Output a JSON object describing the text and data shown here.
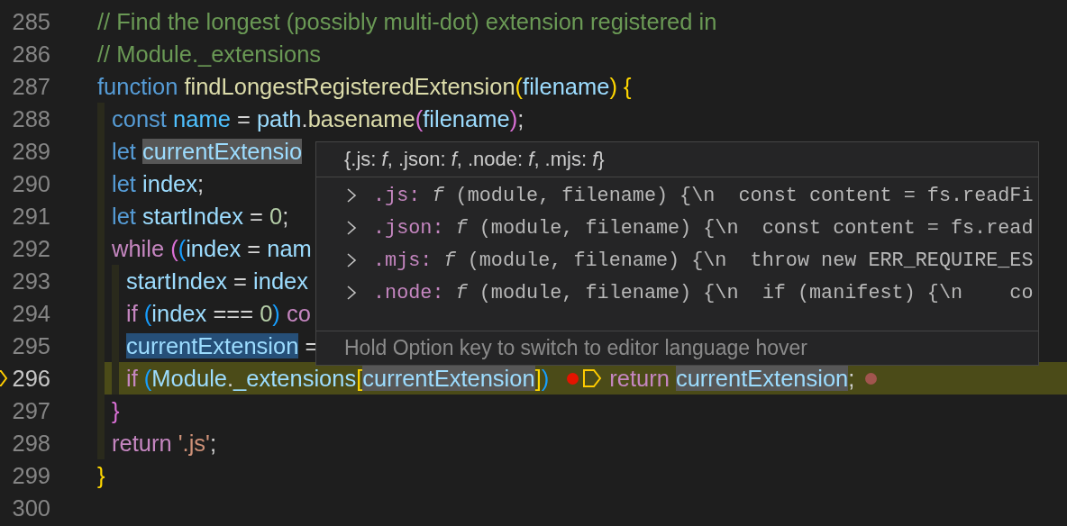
{
  "lines": [
    {
      "number": "285",
      "current": false,
      "tokens": [
        {
          "kind": "comment",
          "text": "// Find the longest (possibly multi-dot) extension registered in"
        }
      ]
    },
    {
      "number": "286",
      "current": false,
      "tokens": [
        {
          "kind": "comment",
          "text": "// Module._extensions"
        }
      ]
    },
    {
      "number": "287",
      "current": false,
      "tokens": [
        {
          "kind": "keyword",
          "text": "function "
        },
        {
          "kind": "fn",
          "text": "findLongestRegisteredExtension"
        },
        {
          "kind": "bracket1",
          "text": "("
        },
        {
          "kind": "var",
          "text": "filename"
        },
        {
          "kind": "bracket1",
          "text": ")"
        },
        {
          "kind": "bracket1",
          "text": " {"
        }
      ],
      "children": [
        {
          "number": "288",
          "current": false,
          "tokens": [
            {
              "kind": "keyword",
              "text": "const "
            },
            {
              "kind": "const",
              "text": "name"
            },
            {
              "kind": "plain",
              "text": " = "
            },
            {
              "kind": "var",
              "text": "path"
            },
            {
              "kind": "plain",
              "text": "."
            },
            {
              "kind": "fn",
              "text": "basename"
            },
            {
              "kind": "bracket2",
              "text": "("
            },
            {
              "kind": "var",
              "text": "filename"
            },
            {
              "kind": "bracket2",
              "text": ")"
            },
            {
              "kind": "plain",
              "text": ";"
            }
          ]
        },
        {
          "number": "289",
          "current": false,
          "tokens": [
            {
              "kind": "keyword",
              "text": "let "
            },
            {
              "kind": "var",
              "text": "currentExtensio",
              "highlighted": true
            }
          ]
        },
        {
          "number": "290",
          "current": false,
          "tokens": [
            {
              "kind": "keyword",
              "text": "let "
            },
            {
              "kind": "var",
              "text": "index"
            },
            {
              "kind": "plain",
              "text": ";"
            }
          ]
        },
        {
          "number": "291",
          "current": false,
          "tokens": [
            {
              "kind": "keyword",
              "text": "let "
            },
            {
              "kind": "var",
              "text": "startIndex"
            },
            {
              "kind": "plain",
              "text": " = "
            },
            {
              "kind": "number",
              "text": "0"
            },
            {
              "kind": "plain",
              "text": ";"
            }
          ]
        },
        {
          "number": "292",
          "current": false,
          "tokens": [
            {
              "kind": "control",
              "text": "while "
            },
            {
              "kind": "bracket2",
              "text": "("
            },
            {
              "kind": "bracket3",
              "text": "("
            },
            {
              "kind": "var",
              "text": "index"
            },
            {
              "kind": "plain",
              "text": " = "
            },
            {
              "kind": "var",
              "text": "nam"
            }
          ],
          "children": [
            {
              "number": "293",
              "current": false,
              "tokens": [
                {
                  "kind": "var",
                  "text": "startIndex"
                },
                {
                  "kind": "plain",
                  "text": " = "
                },
                {
                  "kind": "var",
                  "text": "index"
                }
              ]
            },
            {
              "number": "294",
              "current": false,
              "tokens": [
                {
                  "kind": "control",
                  "text": "if "
                },
                {
                  "kind": "bracket3",
                  "text": "("
                },
                {
                  "kind": "var",
                  "text": "index"
                },
                {
                  "kind": "plain",
                  "text": " === "
                },
                {
                  "kind": "number",
                  "text": "0"
                },
                {
                  "kind": "bracket3",
                  "text": ")"
                },
                {
                  "kind": "control",
                  "text": " co"
                }
              ]
            },
            {
              "number": "295",
              "current": false,
              "tokens": [
                {
                  "kind": "var",
                  "text": "currentExtension",
                  "selected": true
                },
                {
                  "kind": "plain",
                  "text": " ="
                }
              ]
            },
            {
              "number": "296",
              "current": true,
              "tokens": [
                {
                  "kind": "control",
                  "text": "if "
                },
                {
                  "kind": "bracket3",
                  "text": "("
                },
                {
                  "kind": "var",
                  "text": "Module"
                },
                {
                  "kind": "plain",
                  "text": "."
                },
                {
                  "kind": "var",
                  "text": "_extensions"
                },
                {
                  "kind": "bracket1",
                  "text": "["
                },
                {
                  "kind": "var",
                  "text": "currentExtension",
                  "highlighted": true
                },
                {
                  "kind": "bracket1",
                  "text": "]"
                },
                {
                  "kind": "bracket3",
                  "text": ")"
                },
                {
                  "kind": "breakpoint"
                },
                {
                  "kind": "stop-marker"
                },
                {
                  "kind": "control",
                  "text": "return "
                },
                {
                  "kind": "var",
                  "text": "currentExtension",
                  "highlighted": true
                },
                {
                  "kind": "plain",
                  "text": ";"
                },
                {
                  "kind": "breakpoint-dim"
                }
              ]
            }
          ]
        },
        {
          "number": "297",
          "current": false,
          "tokens": [
            {
              "kind": "bracket2",
              "text": "}"
            }
          ]
        },
        {
          "number": "298",
          "current": false,
          "tokens": [
            {
              "kind": "control",
              "text": "return "
            },
            {
              "kind": "string",
              "text": "'.js'"
            },
            {
              "kind": "plain",
              "text": ";"
            }
          ]
        }
      ]
    },
    {
      "number": "299",
      "current": false,
      "tokens": [
        {
          "kind": "bracket1",
          "text": "}"
        }
      ]
    },
    {
      "number": "300",
      "current": false
    }
  ],
  "hover": {
    "title": "{.js: *f*, .json: *f*, .node: *f*, .mjs: *f*}",
    "entries": [
      {
        "key": ".js:",
        "type": "f",
        "value": "(module, filename) {\\n  const content = fs.readFi",
        "expanded": false
      },
      {
        "key": ".json:",
        "type": "f",
        "value": "(module, filename) {\\n  const content = fs.read",
        "expanded": false
      },
      {
        "key": ".mjs:",
        "type": "f",
        "value": "(module, filename) {\\n  throw new ERR_REQUIRE_ES",
        "expanded": false
      },
      {
        "key": ".node:",
        "type": "f",
        "value": "(module, filename) {\\n  if (manifest) {\\n    co",
        "expanded": false
      }
    ],
    "footer": "Hold Option key to switch to editor language hover"
  }
}
